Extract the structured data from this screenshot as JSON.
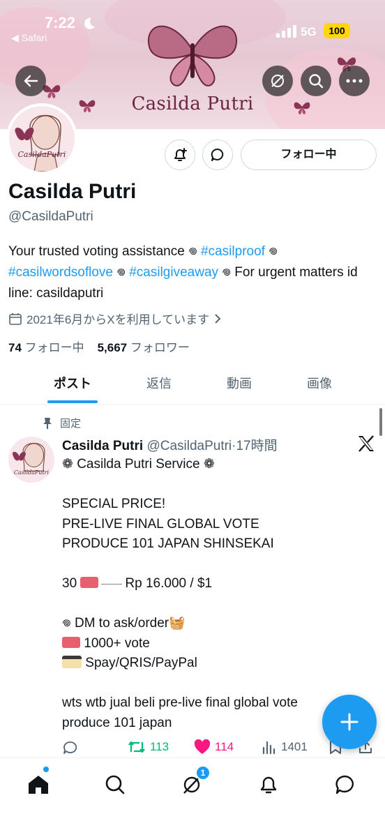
{
  "status_bar": {
    "time": "7:22",
    "back_app": "◀ Safari",
    "network": "5G",
    "battery": "100"
  },
  "banner": {
    "title": "Casilda Putri",
    "avatar_signature": "CasildaPutri"
  },
  "profile": {
    "display_name": "Casilda Putri",
    "handle": "@CasildaPutri",
    "bio": {
      "line1_text": "Your trusted voting assistance ",
      "tag1": "#casilproof",
      "tag2": "#casilwordsoflove",
      "tag3": "#casilgiveaway",
      "separator": "𖦹",
      "tail": " For urgent matters id line: casildaputri"
    },
    "joined": "2021年6月からXを利用しています",
    "following_count": "74",
    "following_label": "フォロー中",
    "followers_count": "5,667",
    "followers_label": "フォロワー",
    "follow_button": "フォロー中"
  },
  "tabs": [
    {
      "label": "ポスト",
      "active": true
    },
    {
      "label": "返信",
      "active": false
    },
    {
      "label": "動画",
      "active": false
    },
    {
      "label": "画像",
      "active": false
    }
  ],
  "post": {
    "pinned_label": "固定",
    "author_name": "Casilda Putri",
    "author_handle": "@CasildaPutri",
    "time": "·17時間",
    "lines": {
      "l1": "❁ Casilda Putri Service ❁",
      "l2": "SPECIAL PRICE!",
      "l3": "PRE-LIVE FINAL GLOBAL VOTE",
      "l4": "PRODUCE 101 JAPAN SHINSEKAI",
      "l5a": "30",
      "l5b": "Rp 16.000 / $1",
      "l6": "𖦹 DM to ask/order🧺",
      "l7": "1000+ vote",
      "l8": "Spay/QRIS/PayPal",
      "l9": "wts wtb jual beli pre-live final global vote",
      "l10": "produce 101 japan"
    },
    "retweets": "113",
    "likes": "114",
    "views": "1401"
  },
  "bottom_nav": {
    "notification_badge": "1"
  },
  "colors": {
    "accent": "#1d9bf0",
    "retweet": "#00ba7c",
    "like": "#f91880",
    "muted": "#536471"
  }
}
